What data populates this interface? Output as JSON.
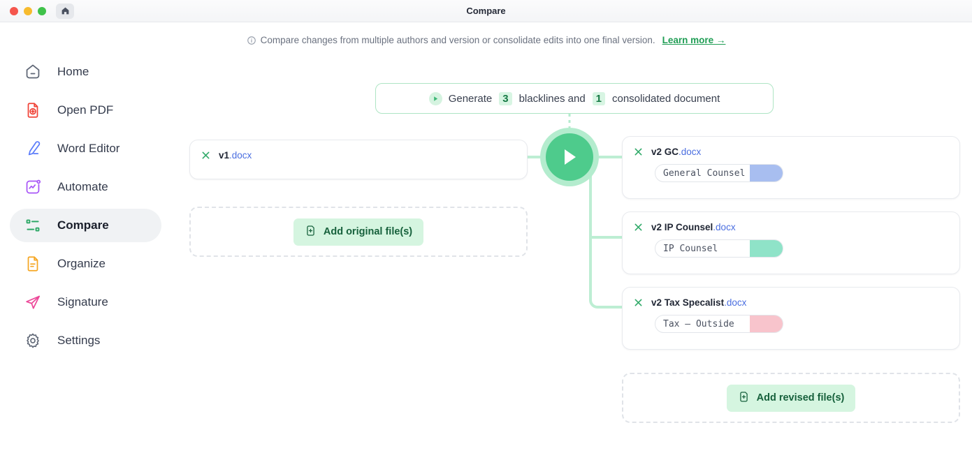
{
  "window": {
    "title": "Compare",
    "traffic_lights": [
      "close",
      "minimize",
      "maximize"
    ],
    "home_button_icon": "home-icon"
  },
  "banner": {
    "icon": "info-circle-icon",
    "text": "Compare changes from multiple authors and version or consolidate edits into one final version.",
    "link_label": "Learn more →",
    "link_color": "#1f9d54"
  },
  "sidebar": {
    "items": [
      {
        "label": "Home",
        "icon": "home-pentagon-icon",
        "color": "#6b7280",
        "active": false
      },
      {
        "label": "Open PDF",
        "icon": "file-plus-icon",
        "color": "#f04438",
        "active": false
      },
      {
        "label": "Word Editor",
        "icon": "pencil-edit-icon",
        "color": "#5b7cfa",
        "active": false
      },
      {
        "label": "Automate",
        "icon": "activity-square-icon",
        "color": "#a855f7",
        "active": false
      },
      {
        "label": "Compare",
        "icon": "git-compare-icon",
        "color": "#2fa968",
        "active": true
      },
      {
        "label": "Organize",
        "icon": "file-lines-icon",
        "color": "#f5a623",
        "active": false
      },
      {
        "label": "Signature",
        "icon": "paper-plane-icon",
        "color": "#ec4899",
        "active": false
      },
      {
        "label": "Settings",
        "icon": "gear-icon",
        "color": "#6b7280",
        "active": false
      }
    ]
  },
  "generate_bar": {
    "icon": "play-circle-icon",
    "text_before": "Generate",
    "blackline_count": "3",
    "text_middle": "blacklines and",
    "document_count": "1",
    "text_after": "consolidated document"
  },
  "run_button": {
    "icon": "play-triangle-icon",
    "ring_color": "#b4ecce",
    "fill_color": "#4ecb8c"
  },
  "original": {
    "files": [
      {
        "close_icon": "close-x-icon",
        "name": "v1",
        "ext": ".docx"
      }
    ],
    "dropzone": {
      "button_label": "Add original file(s)",
      "button_icon": "file-plus-circle-icon"
    }
  },
  "revised": {
    "files": [
      {
        "close_icon": "close-x-icon",
        "name": "v2 GC",
        "ext": ".docx",
        "author": "General Counsel",
        "author_placeholder": "Author name",
        "swatch_color": "#a8bef0"
      },
      {
        "close_icon": "close-x-icon",
        "name": "v2 IP Counsel",
        "ext": ".docx",
        "author": "IP Counsel",
        "author_placeholder": "Author name",
        "swatch_color": "#8fe3c8"
      },
      {
        "close_icon": "close-x-icon",
        "name": "v2 Tax Specalist",
        "ext": ".docx",
        "author": "Tax — Outside",
        "author_placeholder": "Author name",
        "swatch_color": "#f8c4cc"
      }
    ],
    "dropzone": {
      "button_label": "Add revised file(s)",
      "button_icon": "file-plus-circle-icon"
    }
  }
}
